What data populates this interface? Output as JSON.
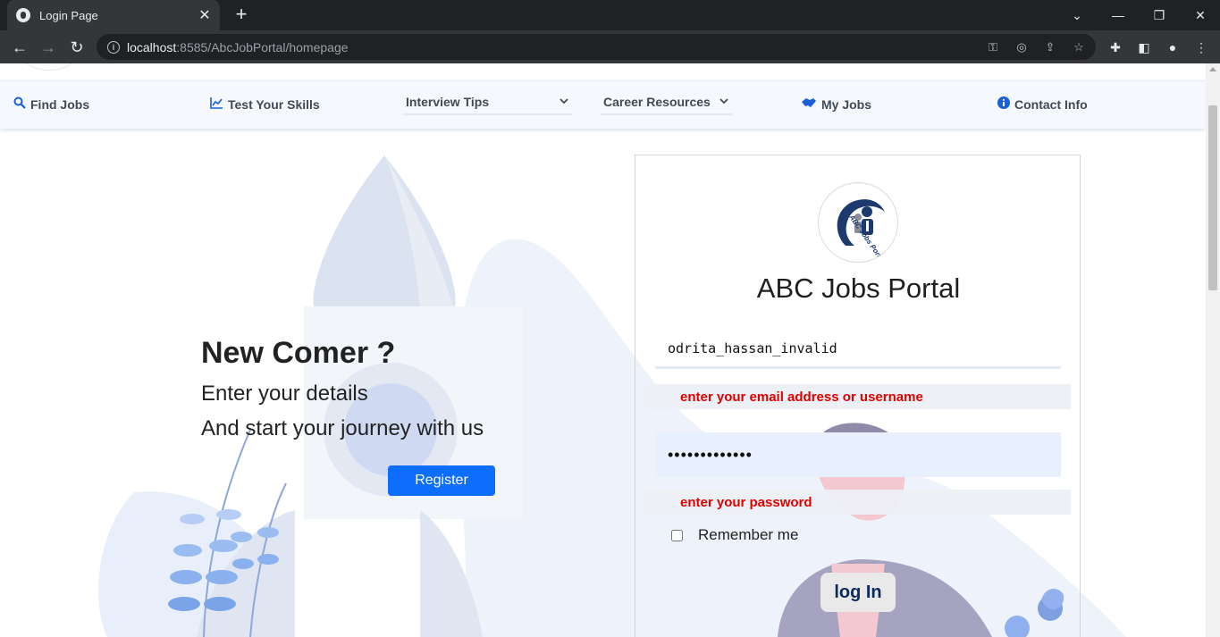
{
  "browser": {
    "tab_title": "Login Page",
    "url_host": "localhost",
    "url_rest": ":8585/AbcJobPortal/homepage"
  },
  "nav": {
    "find_jobs": "Find Jobs",
    "test_skills": "Test Your Skills",
    "interview_tips": "Interview Tips",
    "career_resources": "Career Resources",
    "my_jobs": "My Jobs",
    "contact_info": "Contact Info"
  },
  "newcomer": {
    "title": "New Comer ?",
    "line1": "Enter your details",
    "line2": "And start your journey with us",
    "register_label": "Register"
  },
  "login": {
    "title": "ABC Jobs Portal",
    "username_value": "odrita_hassan_invalid",
    "username_error": "enter your email address or username",
    "password_value": "•••••••••••••",
    "password_error": "enter your password",
    "remember_label": "Remember me",
    "login_label": "log In"
  },
  "logo": {
    "text": "ABC Jobs Portal"
  },
  "colors": {
    "accent": "#0d6efd",
    "error": "#e00000",
    "nav_icon": "#1a5fd6"
  }
}
